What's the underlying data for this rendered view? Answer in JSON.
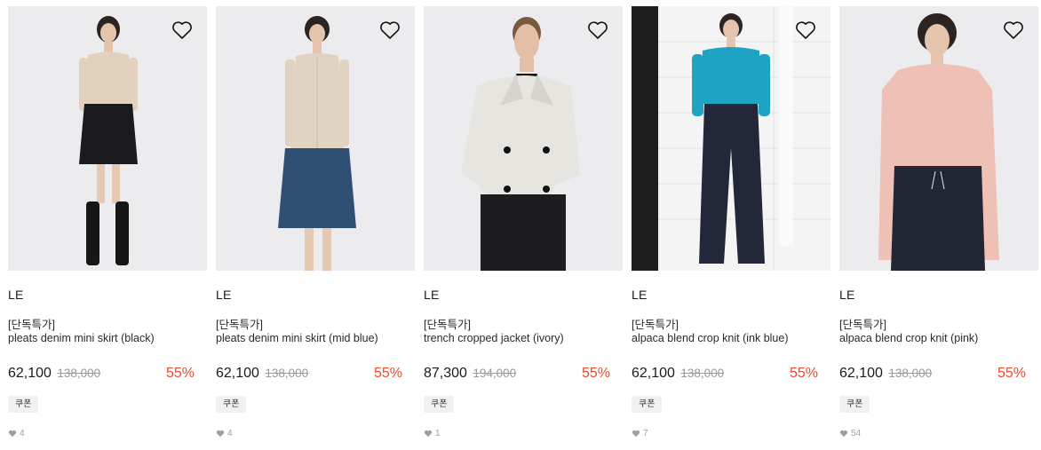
{
  "colors": {
    "discount": "#ef4a2e",
    "muted": "#9a9a9a",
    "coupon_bg": "#f1f1f1"
  },
  "products": [
    {
      "brand": "LE",
      "promo": "[단독특가]",
      "name": "pleats denim mini skirt (black)",
      "price": "62,100",
      "original_price": "138,000",
      "discount": "55%",
      "coupon": "쿠폰",
      "likes": "4",
      "wishlist_icon": "heart-outline-icon",
      "like_icon": "heart-filled-icon"
    },
    {
      "brand": "LE",
      "promo": "[단독특가]",
      "name": "pleats denim mini skirt (mid blue)",
      "price": "62,100",
      "original_price": "138,000",
      "discount": "55%",
      "coupon": "쿠폰",
      "likes": "4",
      "wishlist_icon": "heart-outline-icon",
      "like_icon": "heart-filled-icon"
    },
    {
      "brand": "LE",
      "promo": "[단독특가]",
      "name": "trench cropped jacket (ivory)",
      "price": "87,300",
      "original_price": "194,000",
      "discount": "55%",
      "coupon": "쿠폰",
      "likes": "1",
      "wishlist_icon": "heart-outline-icon",
      "like_icon": "heart-filled-icon"
    },
    {
      "brand": "LE",
      "promo": "[단독특가]",
      "name": "alpaca blend crop knit (ink blue)",
      "price": "62,100",
      "original_price": "138,000",
      "discount": "55%",
      "coupon": "쿠폰",
      "likes": "7",
      "wishlist_icon": "heart-outline-icon",
      "like_icon": "heart-filled-icon"
    },
    {
      "brand": "LE",
      "promo": "[단독특가]",
      "name": "alpaca blend crop knit (pink)",
      "price": "62,100",
      "original_price": "138,000",
      "discount": "55%",
      "coupon": "쿠폰",
      "likes": "54",
      "wishlist_icon": "heart-outline-icon",
      "like_icon": "heart-filled-icon"
    }
  ]
}
